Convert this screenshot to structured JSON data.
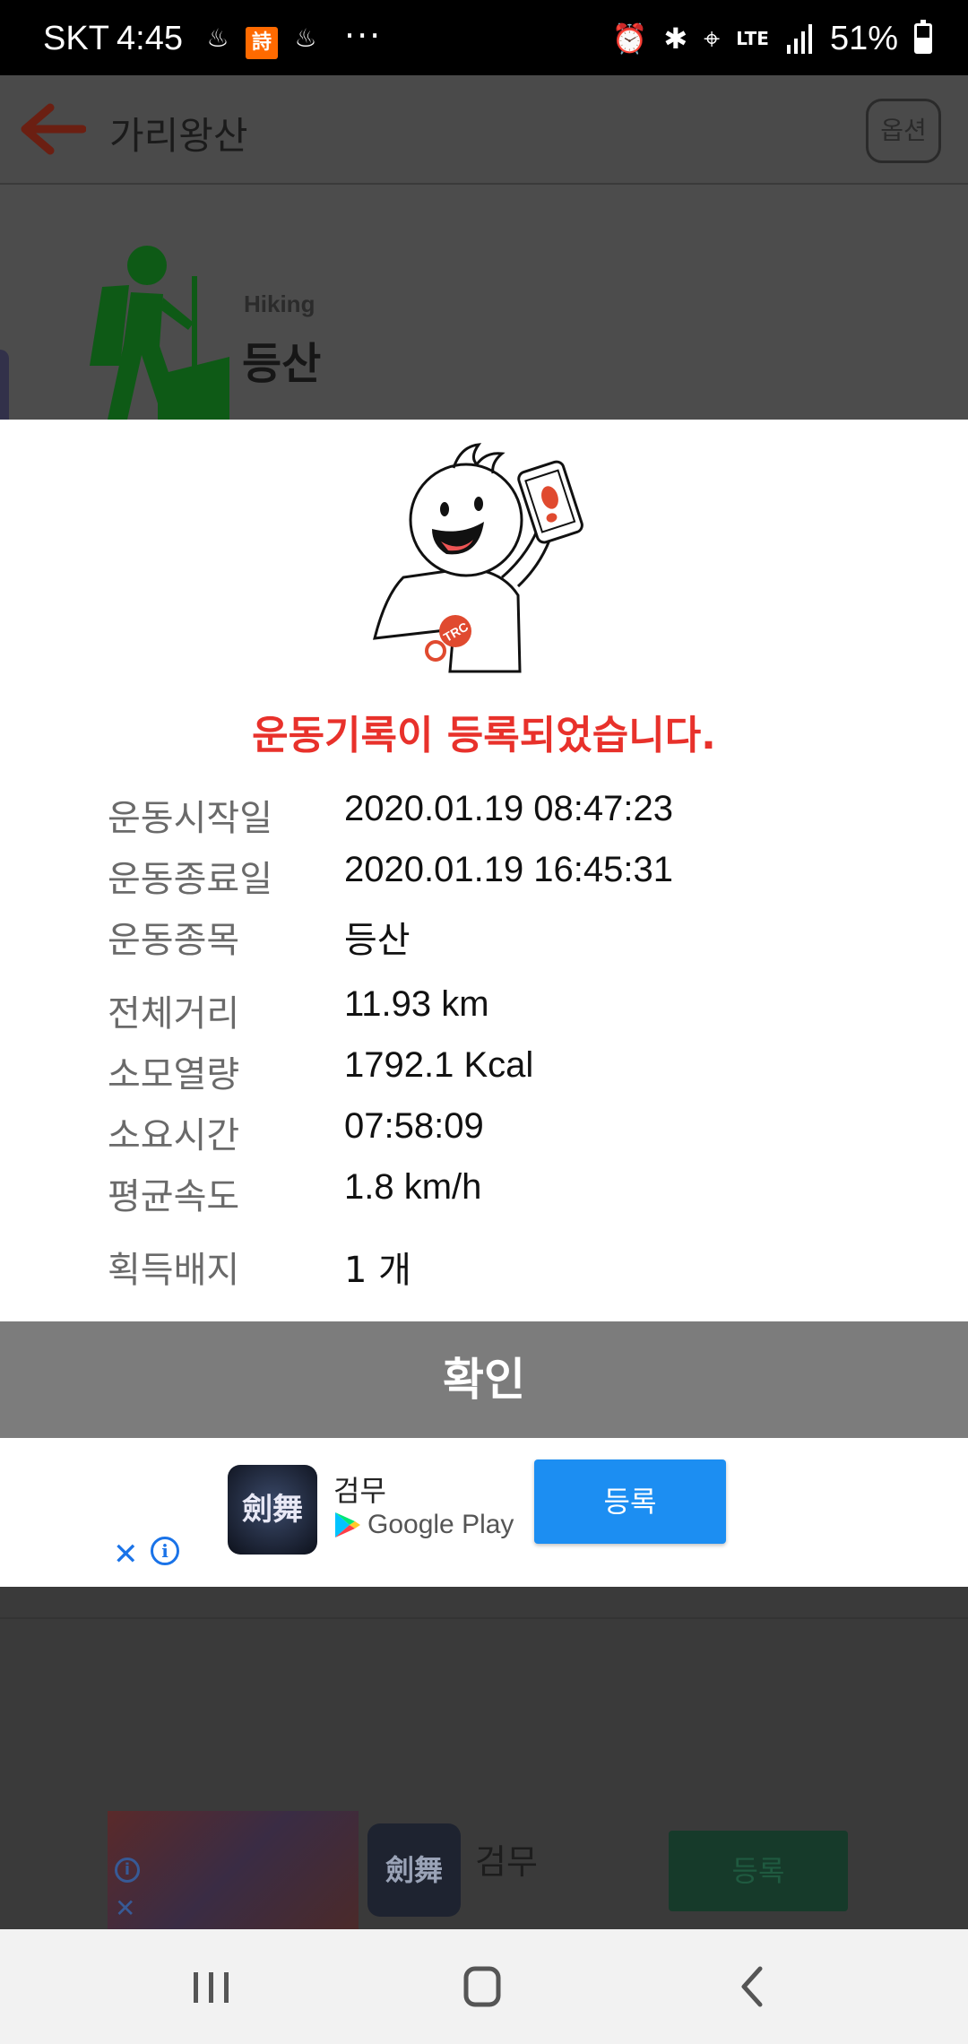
{
  "status_bar": {
    "carrier": "SKT",
    "time": "4:45",
    "notification_badge": "詩",
    "overflow": "···",
    "network": "LTE",
    "battery_percent": "51%",
    "icons": [
      "alarm-icon",
      "bluetooth-icon",
      "location-icon",
      "lte-icon",
      "signal-icon",
      "battery-icon"
    ]
  },
  "app_bar": {
    "title": "가리왕산",
    "options_label": "옵션"
  },
  "background": {
    "activity_subtitle": "Hiking",
    "activity_title": "등산"
  },
  "dialog": {
    "headline": "운동기록이 등록되었습니다.",
    "headline_color": "#e8312b",
    "records": [
      {
        "label": "운동시작일",
        "value": "2020.01.19 08:47:23"
      },
      {
        "label": "운동종료일",
        "value": "2020.01.19 16:45:31"
      },
      {
        "label": "운동종목",
        "value": "등산"
      },
      {
        "label": "전체거리",
        "value": "11.93 km"
      },
      {
        "label": "소모열량",
        "value": "1792.1 Kcal"
      },
      {
        "label": "소요시간",
        "value": "07:58:09"
      },
      {
        "label": "평균속도",
        "value": "1.8 km/h"
      },
      {
        "label": "획득배지",
        "value": "1 개"
      }
    ],
    "confirm_label": "확인",
    "mascot_badge": "TRC"
  },
  "ad": {
    "app_name": "검무",
    "store_name": "Google Play",
    "install_label": "등록",
    "close_glyph": "✕",
    "info_glyph": "i",
    "icon_text": "劍舞",
    "button_color": "#1c8ef2"
  },
  "background_ad": {
    "app_name": "검무",
    "install_label": "등록",
    "icon_text": "劍舞"
  }
}
